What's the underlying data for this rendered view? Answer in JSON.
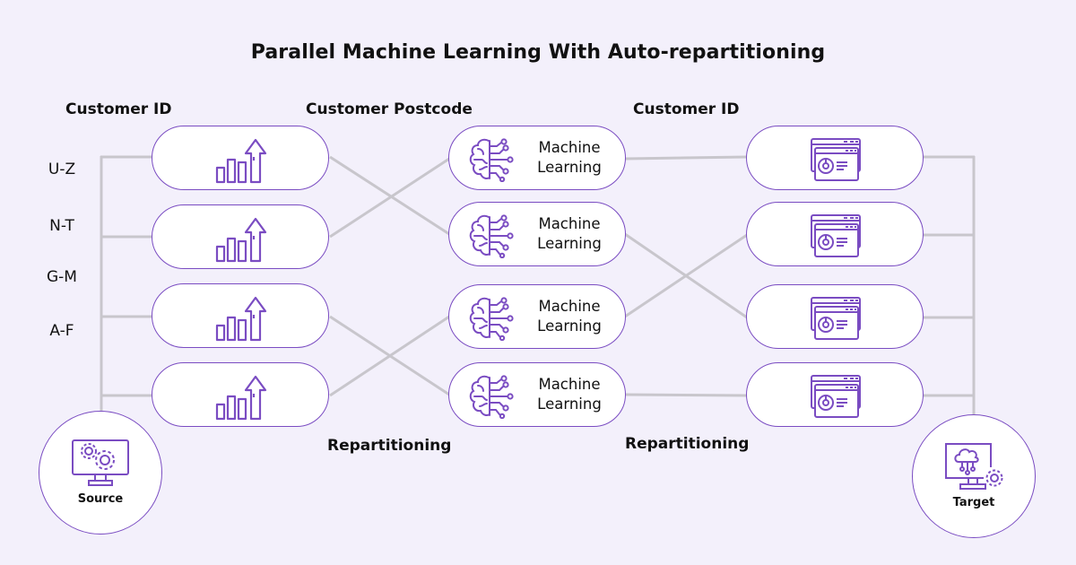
{
  "title": "Parallel Machine Learning With Auto-repartitioning",
  "column_headers": [
    "Customer ID",
    "Customer Postcode",
    "Customer ID"
  ],
  "key_ranges": [
    "U-Z",
    "N-T",
    "G-M",
    "A-F"
  ],
  "repartition_labels": [
    "Repartitioning",
    "Repartitioning"
  ],
  "source": {
    "label": "Source",
    "icon": "monitor-gears-icon"
  },
  "target": {
    "label": "Target",
    "icon": "monitor-cloud-gear-icon"
  },
  "input_nodes": [
    {
      "icon": "bar-chart-growth-icon"
    },
    {
      "icon": "bar-chart-growth-icon"
    },
    {
      "icon": "bar-chart-growth-icon"
    },
    {
      "icon": "bar-chart-growth-icon"
    }
  ],
  "ml_nodes": [
    {
      "label_line1": "Machine",
      "label_line2": "Learning",
      "icon": "ai-brain-icon"
    },
    {
      "label_line1": "Machine",
      "label_line2": "Learning",
      "icon": "ai-brain-icon"
    },
    {
      "label_line1": "Machine",
      "label_line2": "Learning",
      "icon": "ai-brain-icon"
    },
    {
      "label_line1": "Machine",
      "label_line2": "Learning",
      "icon": "ai-brain-icon"
    }
  ],
  "output_nodes": [
    {
      "icon": "browser-dashboard-icon"
    },
    {
      "icon": "browser-dashboard-icon"
    },
    {
      "icon": "browser-dashboard-icon"
    },
    {
      "icon": "browser-dashboard-icon"
    }
  ],
  "connections": {
    "input_to_ml": [
      [
        1,
        2
      ],
      [
        2,
        1
      ],
      [
        3,
        4
      ],
      [
        4,
        3
      ]
    ],
    "ml_to_output": [
      [
        1,
        1
      ],
      [
        2,
        3
      ],
      [
        3,
        2
      ],
      [
        4,
        4
      ]
    ]
  },
  "colors": {
    "accent": "#7a4cc2",
    "wire": "#c8c6cc",
    "background": "#f3f0fb"
  }
}
